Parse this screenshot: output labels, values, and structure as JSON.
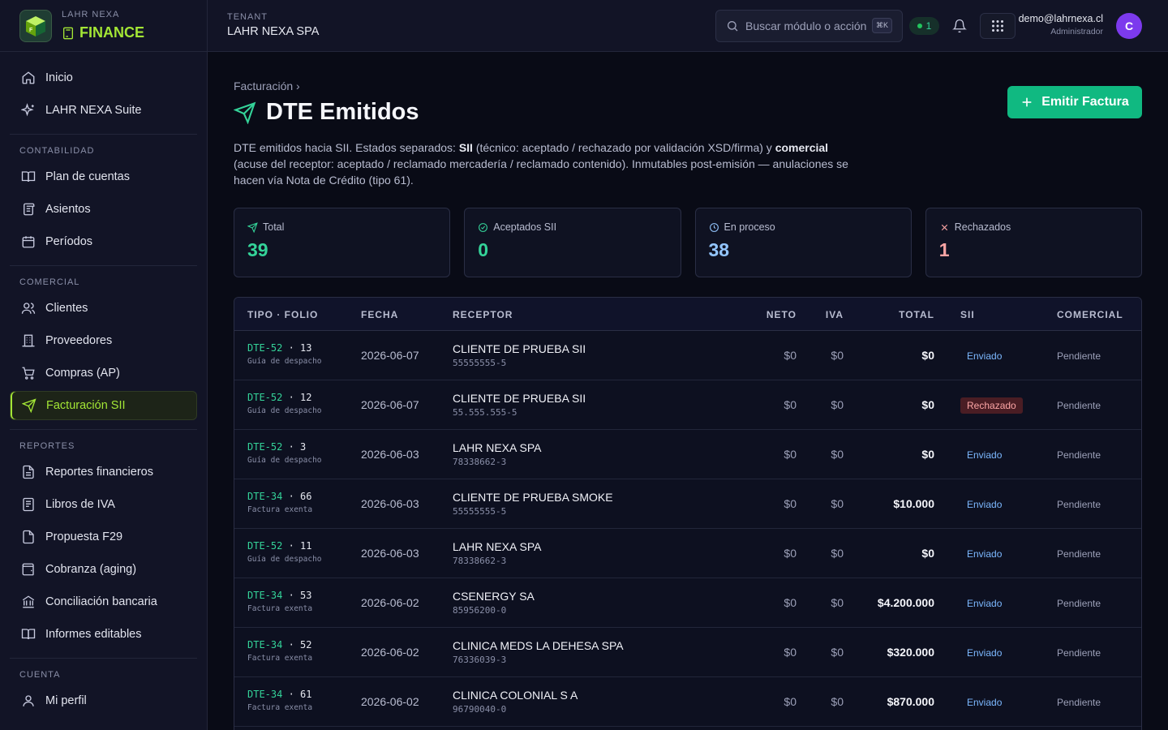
{
  "brand": {
    "top": "LAHR NEXA",
    "name": "FINANCE"
  },
  "sidebar": {
    "top_items": [
      {
        "label": "Inicio",
        "icon": "home-icon"
      },
      {
        "label": "LAHR NEXA Suite",
        "icon": "sparkle-icon"
      }
    ],
    "sections": [
      {
        "title": "CONTABILIDAD",
        "items": [
          {
            "label": "Plan de cuentas",
            "icon": "book-icon"
          },
          {
            "label": "Asientos",
            "icon": "scroll-icon"
          },
          {
            "label": "Períodos",
            "icon": "calendar-icon"
          }
        ]
      },
      {
        "title": "COMERCIAL",
        "items": [
          {
            "label": "Clientes",
            "icon": "users-icon"
          },
          {
            "label": "Proveedores",
            "icon": "building-icon"
          },
          {
            "label": "Compras (AP)",
            "icon": "cart-icon"
          },
          {
            "label": "Facturación SII",
            "icon": "send-icon",
            "active": true
          }
        ]
      },
      {
        "title": "REPORTES",
        "items": [
          {
            "label": "Reportes financieros",
            "icon": "file-text-icon"
          },
          {
            "label": "Libros de IVA",
            "icon": "notebook-icon"
          },
          {
            "label": "Propuesta F29",
            "icon": "calculator-file-icon"
          },
          {
            "label": "Cobranza (aging)",
            "icon": "wallet-icon"
          },
          {
            "label": "Conciliación bancaria",
            "icon": "bank-icon"
          },
          {
            "label": "Informes editables",
            "icon": "open-book-icon"
          }
        ]
      },
      {
        "title": "CUENTA",
        "items": [
          {
            "label": "Mi perfil",
            "icon": "user-icon"
          }
        ]
      }
    ]
  },
  "header": {
    "tenant_label": "TENANT",
    "tenant_name": "LAHR NEXA SPA",
    "search_placeholder": "Buscar módulo o acción",
    "search_shortcut": "⌘K",
    "status_count": "1",
    "user_email": "demo@lahrnexa.cl",
    "user_role": "Administrador",
    "avatar_initial": "C"
  },
  "page": {
    "breadcrumb": "Facturación ›",
    "title": "DTE Emitidos",
    "emit_button": "Emitir Factura",
    "desc_1": "DTE emitidos hacia SII. Estados separados: ",
    "desc_b1": "SII",
    "desc_2": " (técnico: aceptado / rechazado por validación XSD/firma) y ",
    "desc_b2": "comercial",
    "desc_3": " (acuse del receptor: aceptado / reclamado mercadería / reclamado contenido). Inmutables post-emisión — anulaciones se hacen vía Nota de Crédito (tipo 61)."
  },
  "stats": [
    {
      "label": "Total",
      "value": "39",
      "color": "#34d399",
      "icon": "send-icon"
    },
    {
      "label": "Aceptados SII",
      "value": "0",
      "color": "#34d399",
      "icon": "check-circle-icon"
    },
    {
      "label": "En proceso",
      "value": "38",
      "color": "#93c5fd",
      "icon": "clock-icon"
    },
    {
      "label": "Rechazados",
      "value": "1",
      "color": "#fca5a5",
      "icon": "x-icon"
    }
  ],
  "table": {
    "headers": {
      "tipo": "TIPO · FOLIO",
      "fecha": "FECHA",
      "receptor": "RECEPTOR",
      "neto": "NETO",
      "iva": "IVA",
      "total": "TOTAL",
      "sii": "SII",
      "comercial": "COMERCIAL"
    },
    "rows": [
      {
        "tipo": "DTE-52",
        "folio": " · 13",
        "sub": "Guía de despacho",
        "fecha": "2026-06-07",
        "receptor": "CLIENTE DE PRUEBA SII",
        "rut": "55555555-5",
        "neto": "$0",
        "iva": "$0",
        "total": "$0",
        "sii": "Enviado",
        "comercial": "Pendiente"
      },
      {
        "tipo": "DTE-52",
        "folio": " · 12",
        "sub": "Guía de despacho",
        "fecha": "2026-06-07",
        "receptor": "CLIENTE DE PRUEBA SII",
        "rut": "55.555.555-5",
        "neto": "$0",
        "iva": "$0",
        "total": "$0",
        "sii": "Rechazado",
        "comercial": "Pendiente"
      },
      {
        "tipo": "DTE-52",
        "folio": " · 3",
        "sub": "Guía de despacho",
        "fecha": "2026-06-03",
        "receptor": "LAHR NEXA SPA",
        "rut": "78338662-3",
        "neto": "$0",
        "iva": "$0",
        "total": "$0",
        "sii": "Enviado",
        "comercial": "Pendiente"
      },
      {
        "tipo": "DTE-34",
        "folio": " · 66",
        "sub": "Factura exenta",
        "fecha": "2026-06-03",
        "receptor": "CLIENTE DE PRUEBA SMOKE",
        "rut": "55555555-5",
        "neto": "$0",
        "iva": "$0",
        "total": "$10.000",
        "sii": "Enviado",
        "comercial": "Pendiente"
      },
      {
        "tipo": "DTE-52",
        "folio": " · 11",
        "sub": "Guía de despacho",
        "fecha": "2026-06-03",
        "receptor": "LAHR NEXA SPA",
        "rut": "78338662-3",
        "neto": "$0",
        "iva": "$0",
        "total": "$0",
        "sii": "Enviado",
        "comercial": "Pendiente"
      },
      {
        "tipo": "DTE-34",
        "folio": " · 53",
        "sub": "Factura exenta",
        "fecha": "2026-06-02",
        "receptor": "CSENERGY SA",
        "rut": "85956200-0",
        "neto": "$0",
        "iva": "$0",
        "total": "$4.200.000",
        "sii": "Enviado",
        "comercial": "Pendiente"
      },
      {
        "tipo": "DTE-34",
        "folio": " · 52",
        "sub": "Factura exenta",
        "fecha": "2026-06-02",
        "receptor": "CLINICA MEDS LA DEHESA SPA",
        "rut": "76336039-3",
        "neto": "$0",
        "iva": "$0",
        "total": "$320.000",
        "sii": "Enviado",
        "comercial": "Pendiente"
      },
      {
        "tipo": "DTE-34",
        "folio": " · 61",
        "sub": "Factura exenta",
        "fecha": "2026-06-02",
        "receptor": "CLINICA COLONIAL S A",
        "rut": "96790040-0",
        "neto": "$0",
        "iva": "$0",
        "total": "$870.000",
        "sii": "Enviado",
        "comercial": "Pendiente"
      }
    ]
  }
}
